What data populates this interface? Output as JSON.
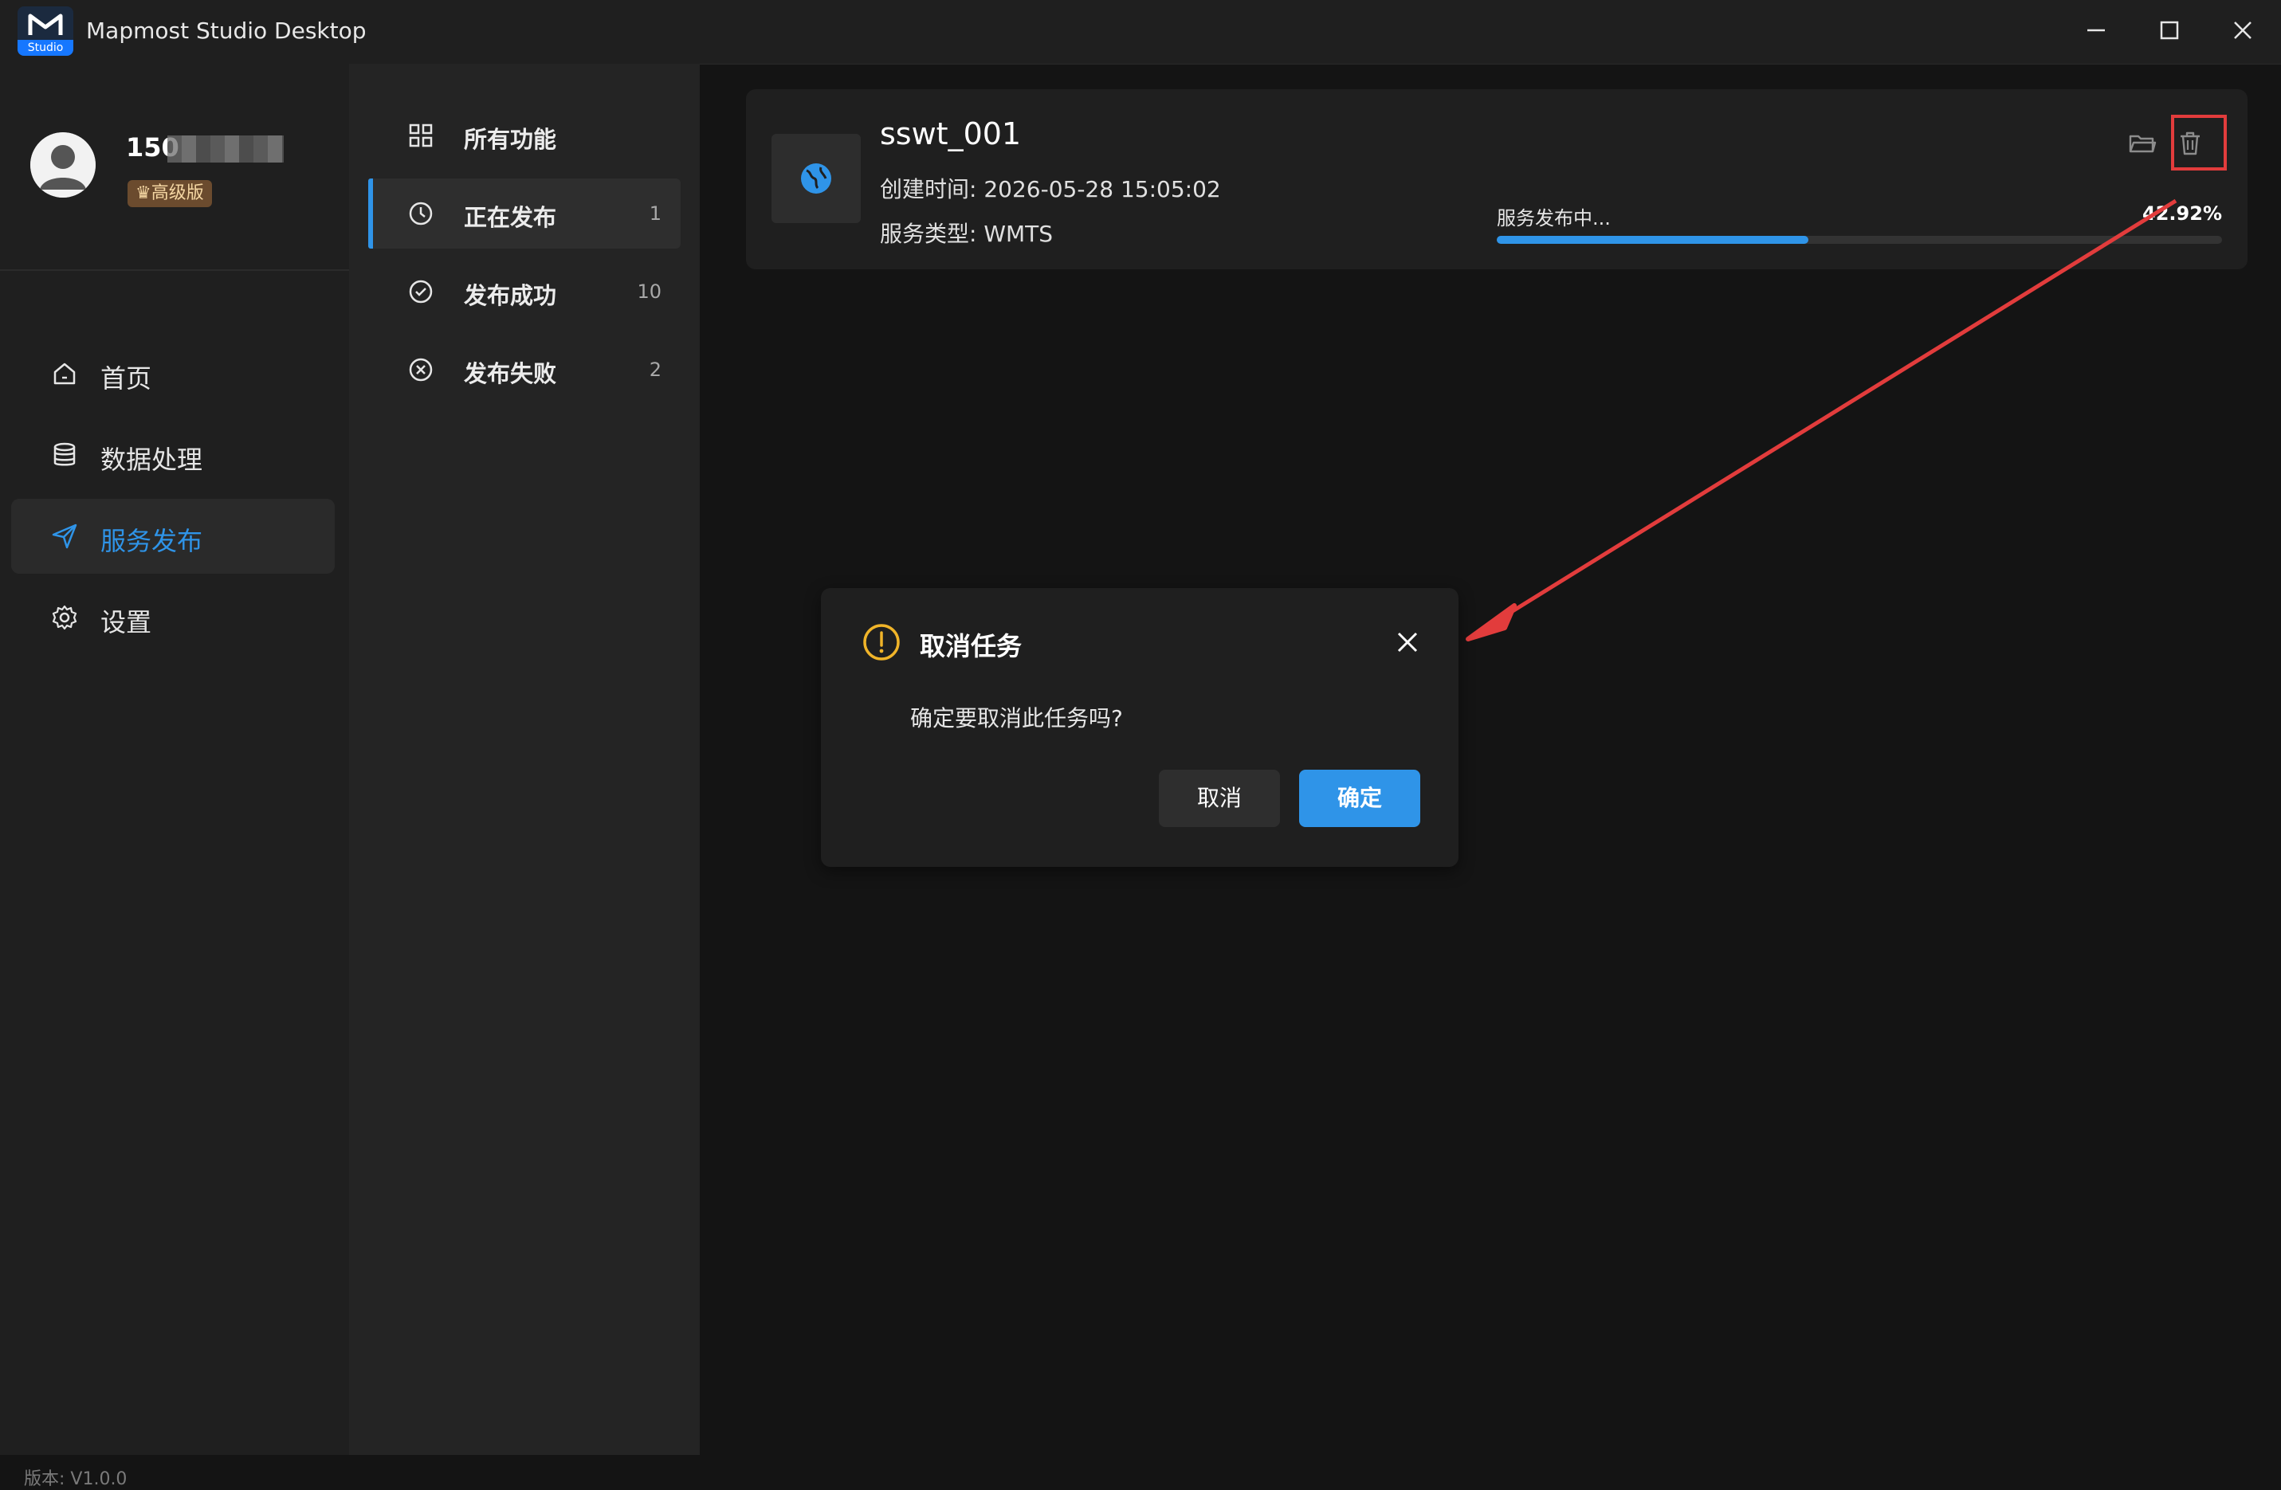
{
  "window": {
    "title": "Mapmost Studio Desktop",
    "logo_text": "Studio"
  },
  "sidebar": {
    "user": {
      "name_prefix": "150",
      "badge": "高级版"
    },
    "items": [
      {
        "label": "首页",
        "icon": "home-icon"
      },
      {
        "label": "数据处理",
        "icon": "database-icon"
      },
      {
        "label": "服务发布",
        "icon": "send-icon",
        "active": true
      },
      {
        "label": "设置",
        "icon": "settings-icon"
      }
    ],
    "version": "版本: V1.0.0"
  },
  "subnav": {
    "items": [
      {
        "label": "所有功能",
        "count": "",
        "icon": "grid-icon"
      },
      {
        "label": "正在发布",
        "count": "1",
        "icon": "clock-icon",
        "active": true
      },
      {
        "label": "发布成功",
        "count": "10",
        "icon": "check-circle-icon"
      },
      {
        "label": "发布失败",
        "count": "2",
        "icon": "x-circle-icon"
      }
    ]
  },
  "task_card": {
    "name": "sswt_001",
    "created": "创建时间: 2026-05-28 15:05:02",
    "service_type": "服务类型: WMTS",
    "status": "服务发布中...",
    "progress_text": "42.92%",
    "progress_value": 42.92
  },
  "dialog": {
    "title": "取消任务",
    "message": "确定要取消此任务吗?",
    "cancel_label": "取消",
    "confirm_label": "确定"
  },
  "colors": {
    "accent": "#2f94e8",
    "warning": "#f0b429",
    "annotation": "#e23c3c"
  }
}
